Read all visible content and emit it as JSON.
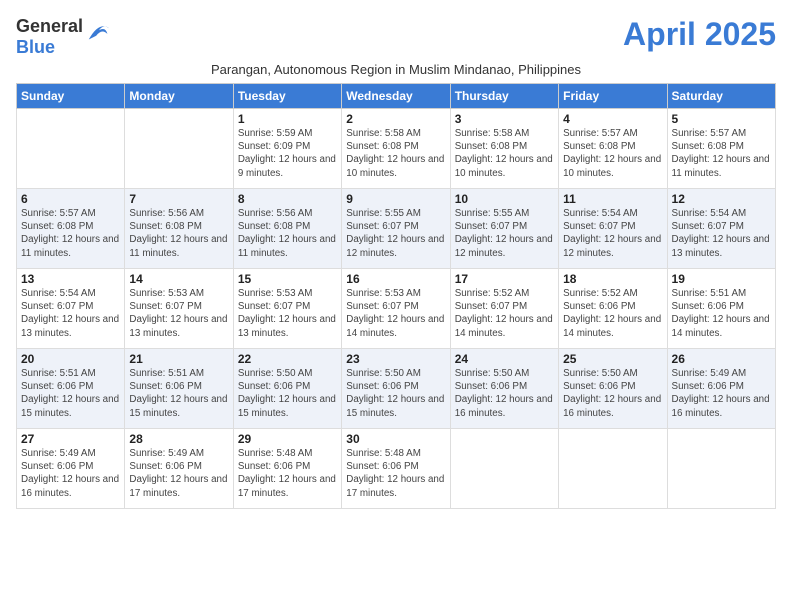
{
  "header": {
    "logo_general": "General",
    "logo_blue": "Blue",
    "month_title": "April 2025",
    "subtitle": "Parangan, Autonomous Region in Muslim Mindanao, Philippines"
  },
  "weekdays": [
    "Sunday",
    "Monday",
    "Tuesday",
    "Wednesday",
    "Thursday",
    "Friday",
    "Saturday"
  ],
  "weeks": [
    [
      {
        "day": "",
        "info": ""
      },
      {
        "day": "",
        "info": ""
      },
      {
        "day": "1",
        "info": "Sunrise: 5:59 AM\nSunset: 6:09 PM\nDaylight: 12 hours and 9 minutes."
      },
      {
        "day": "2",
        "info": "Sunrise: 5:58 AM\nSunset: 6:08 PM\nDaylight: 12 hours and 10 minutes."
      },
      {
        "day": "3",
        "info": "Sunrise: 5:58 AM\nSunset: 6:08 PM\nDaylight: 12 hours and 10 minutes."
      },
      {
        "day": "4",
        "info": "Sunrise: 5:57 AM\nSunset: 6:08 PM\nDaylight: 12 hours and 10 minutes."
      },
      {
        "day": "5",
        "info": "Sunrise: 5:57 AM\nSunset: 6:08 PM\nDaylight: 12 hours and 11 minutes."
      }
    ],
    [
      {
        "day": "6",
        "info": "Sunrise: 5:57 AM\nSunset: 6:08 PM\nDaylight: 12 hours and 11 minutes."
      },
      {
        "day": "7",
        "info": "Sunrise: 5:56 AM\nSunset: 6:08 PM\nDaylight: 12 hours and 11 minutes."
      },
      {
        "day": "8",
        "info": "Sunrise: 5:56 AM\nSunset: 6:08 PM\nDaylight: 12 hours and 11 minutes."
      },
      {
        "day": "9",
        "info": "Sunrise: 5:55 AM\nSunset: 6:07 PM\nDaylight: 12 hours and 12 minutes."
      },
      {
        "day": "10",
        "info": "Sunrise: 5:55 AM\nSunset: 6:07 PM\nDaylight: 12 hours and 12 minutes."
      },
      {
        "day": "11",
        "info": "Sunrise: 5:54 AM\nSunset: 6:07 PM\nDaylight: 12 hours and 12 minutes."
      },
      {
        "day": "12",
        "info": "Sunrise: 5:54 AM\nSunset: 6:07 PM\nDaylight: 12 hours and 13 minutes."
      }
    ],
    [
      {
        "day": "13",
        "info": "Sunrise: 5:54 AM\nSunset: 6:07 PM\nDaylight: 12 hours and 13 minutes."
      },
      {
        "day": "14",
        "info": "Sunrise: 5:53 AM\nSunset: 6:07 PM\nDaylight: 12 hours and 13 minutes."
      },
      {
        "day": "15",
        "info": "Sunrise: 5:53 AM\nSunset: 6:07 PM\nDaylight: 12 hours and 13 minutes."
      },
      {
        "day": "16",
        "info": "Sunrise: 5:53 AM\nSunset: 6:07 PM\nDaylight: 12 hours and 14 minutes."
      },
      {
        "day": "17",
        "info": "Sunrise: 5:52 AM\nSunset: 6:07 PM\nDaylight: 12 hours and 14 minutes."
      },
      {
        "day": "18",
        "info": "Sunrise: 5:52 AM\nSunset: 6:06 PM\nDaylight: 12 hours and 14 minutes."
      },
      {
        "day": "19",
        "info": "Sunrise: 5:51 AM\nSunset: 6:06 PM\nDaylight: 12 hours and 14 minutes."
      }
    ],
    [
      {
        "day": "20",
        "info": "Sunrise: 5:51 AM\nSunset: 6:06 PM\nDaylight: 12 hours and 15 minutes."
      },
      {
        "day": "21",
        "info": "Sunrise: 5:51 AM\nSunset: 6:06 PM\nDaylight: 12 hours and 15 minutes."
      },
      {
        "day": "22",
        "info": "Sunrise: 5:50 AM\nSunset: 6:06 PM\nDaylight: 12 hours and 15 minutes."
      },
      {
        "day": "23",
        "info": "Sunrise: 5:50 AM\nSunset: 6:06 PM\nDaylight: 12 hours and 15 minutes."
      },
      {
        "day": "24",
        "info": "Sunrise: 5:50 AM\nSunset: 6:06 PM\nDaylight: 12 hours and 16 minutes."
      },
      {
        "day": "25",
        "info": "Sunrise: 5:50 AM\nSunset: 6:06 PM\nDaylight: 12 hours and 16 minutes."
      },
      {
        "day": "26",
        "info": "Sunrise: 5:49 AM\nSunset: 6:06 PM\nDaylight: 12 hours and 16 minutes."
      }
    ],
    [
      {
        "day": "27",
        "info": "Sunrise: 5:49 AM\nSunset: 6:06 PM\nDaylight: 12 hours and 16 minutes."
      },
      {
        "day": "28",
        "info": "Sunrise: 5:49 AM\nSunset: 6:06 PM\nDaylight: 12 hours and 17 minutes."
      },
      {
        "day": "29",
        "info": "Sunrise: 5:48 AM\nSunset: 6:06 PM\nDaylight: 12 hours and 17 minutes."
      },
      {
        "day": "30",
        "info": "Sunrise: 5:48 AM\nSunset: 6:06 PM\nDaylight: 12 hours and 17 minutes."
      },
      {
        "day": "",
        "info": ""
      },
      {
        "day": "",
        "info": ""
      },
      {
        "day": "",
        "info": ""
      }
    ]
  ]
}
